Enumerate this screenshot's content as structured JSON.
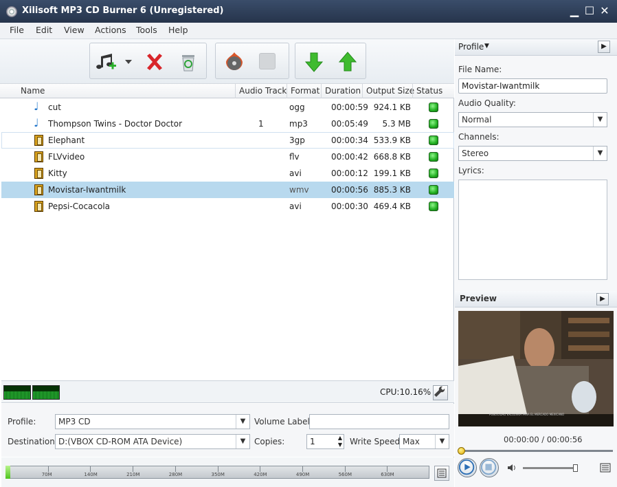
{
  "window": {
    "title": "Xilisoft MP3 CD Burner 6 (Unregistered)",
    "minimize": "▁",
    "maximize": "☐",
    "close": "✕"
  },
  "menu": [
    "File",
    "Edit",
    "View",
    "Actions",
    "Tools",
    "Help"
  ],
  "toolbar": {
    "add_icon": "music-note-add-icon",
    "remove_icon": "red-x-icon",
    "clear_icon": "recycle-bin-icon",
    "burn_icon": "burn-disc-icon",
    "stop_icon": "stop-square-icon",
    "move_down_icon": "green-down-arrow-icon",
    "move_up_icon": "green-up-arrow-icon"
  },
  "columns": [
    "Name",
    "Audio Track",
    "Format",
    "Duration",
    "Output Size",
    "Status"
  ],
  "files": [
    {
      "icon": "music-note-icon",
      "name": "cut",
      "track": "",
      "format": "ogg",
      "duration": "00:00:59",
      "size": "924.1 KB"
    },
    {
      "icon": "music-note-icon",
      "name": "Thompson Twins - Doctor Doctor",
      "track": "1",
      "format": "mp3",
      "duration": "00:05:49",
      "size": "5.3 MB"
    },
    {
      "icon": "film-icon",
      "name": "Elephant",
      "track": "",
      "format": "3gp",
      "duration": "00:00:34",
      "size": "533.9 KB"
    },
    {
      "icon": "film-icon",
      "name": "FLVvideo",
      "track": "",
      "format": "flv",
      "duration": "00:00:42",
      "size": "668.8 KB"
    },
    {
      "icon": "film-icon",
      "name": "Kitty",
      "track": "",
      "format": "avi",
      "duration": "00:00:12",
      "size": "199.1 KB"
    },
    {
      "icon": "film-icon",
      "name": "Movistar-Iwantmilk",
      "track": "",
      "format": "wmv",
      "duration": "00:00:56",
      "size": "885.3 KB"
    },
    {
      "icon": "film-icon",
      "name": "Pepsi-Cocacola",
      "track": "",
      "format": "avi",
      "duration": "00:00:30",
      "size": "469.4 KB"
    }
  ],
  "status_color": "#22b022",
  "cpu": "CPU:10.16%",
  "settings": {
    "profile_label": "Profile:",
    "profile_value": "MP3 CD",
    "destination_label": "Destination:",
    "destination_value": "D:(VBOX CD-ROM ATA Device)",
    "volume_label": "Volume Label:",
    "volume_value": "",
    "copies_label": "Copies:",
    "copies_value": "1",
    "write_speed_label": "Write Speed:",
    "write_speed_value": "Max"
  },
  "capacity": {
    "ticks": [
      "70M",
      "140M",
      "210M",
      "280M",
      "350M",
      "420M",
      "490M",
      "560M",
      "630M"
    ],
    "used_fraction": 0.012
  },
  "profile_panel": {
    "title": "Profile",
    "file_name_label": "File Name:",
    "file_name_value": "Movistar-Iwantmilk",
    "audio_quality_label": "Audio Quality:",
    "audio_quality_value": "Normal",
    "channels_label": "Channels:",
    "channels_value": "Stereo",
    "lyrics_label": "Lyrics:"
  },
  "preview": {
    "title": "Preview",
    "time": "00:00:00 / 00:00:56",
    "caption": "PUBLICIDAD EXCLUSIVA PARA EL MERCADO MEXICANO"
  }
}
